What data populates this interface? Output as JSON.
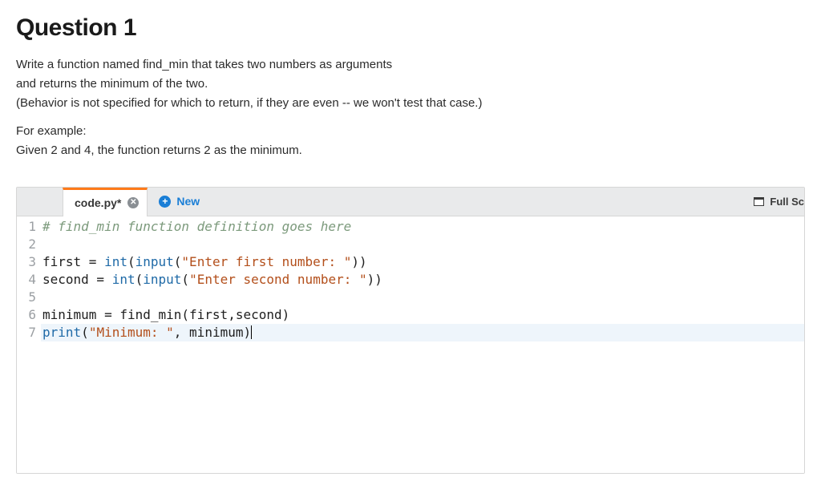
{
  "question": {
    "title": "Question 1",
    "p1": "Write a function named find_min that takes two numbers as arguments",
    "p2": "and returns the minimum of the two.",
    "p3": "(Behavior is not specified for which to return, if they are even -- we won't test that case.)",
    "p4": "For example:",
    "p5": "Given 2 and 4, the function returns 2 as the minimum."
  },
  "tabs": {
    "active_label": "code.py*",
    "new_label": "New",
    "fullscreen_label": "Full Sc"
  },
  "code": {
    "lines": [
      {
        "n": 1,
        "segments": [
          {
            "cls": "c-comment",
            "t": "# find_min function definition goes here"
          }
        ]
      },
      {
        "n": 2,
        "segments": []
      },
      {
        "n": 3,
        "segments": [
          {
            "cls": "",
            "t": "first = "
          },
          {
            "cls": "c-builtin",
            "t": "int"
          },
          {
            "cls": "",
            "t": "("
          },
          {
            "cls": "c-builtin",
            "t": "input"
          },
          {
            "cls": "",
            "t": "("
          },
          {
            "cls": "c-str",
            "t": "\"Enter first number: \""
          },
          {
            "cls": "",
            "t": "))"
          }
        ]
      },
      {
        "n": 4,
        "segments": [
          {
            "cls": "",
            "t": "second = "
          },
          {
            "cls": "c-builtin",
            "t": "int"
          },
          {
            "cls": "",
            "t": "("
          },
          {
            "cls": "c-builtin",
            "t": "input"
          },
          {
            "cls": "",
            "t": "("
          },
          {
            "cls": "c-str",
            "t": "\"Enter second number: \""
          },
          {
            "cls": "",
            "t": "))"
          }
        ]
      },
      {
        "n": 5,
        "segments": []
      },
      {
        "n": 6,
        "segments": [
          {
            "cls": "",
            "t": "minimum = find_min(first,second)"
          }
        ]
      },
      {
        "n": 7,
        "highlight": true,
        "caret_after": true,
        "segments": [
          {
            "cls": "c-builtin",
            "t": "print"
          },
          {
            "cls": "",
            "t": "("
          },
          {
            "cls": "c-str",
            "t": "\"Minimum: \""
          },
          {
            "cls": "",
            "t": ", minimum)"
          }
        ]
      }
    ]
  }
}
